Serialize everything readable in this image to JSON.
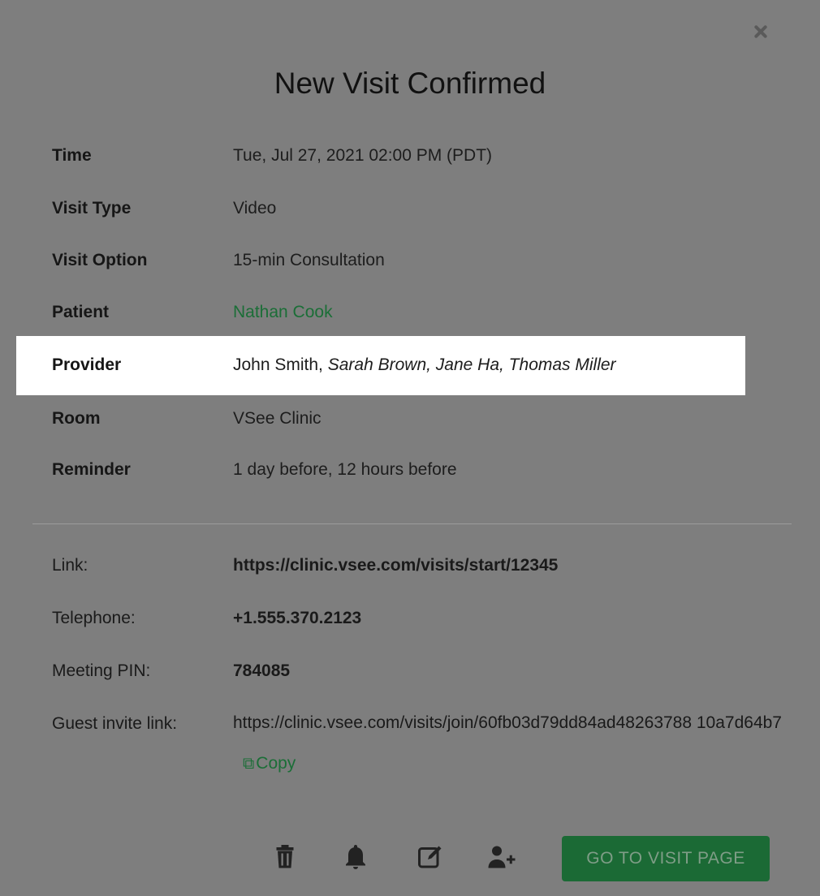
{
  "modal": {
    "title": "New Visit Confirmed"
  },
  "details": {
    "time_label": "Time",
    "time_value": "Tue, Jul 27, 2021 02:00 PM (PDT)",
    "visit_type_label": "Visit Type",
    "visit_type_value": "Video",
    "visit_option_label": "Visit Option",
    "visit_option_value": "15-min Consultation",
    "patient_label": "Patient",
    "patient_value": "Nathan Cook",
    "provider_label": "Provider",
    "provider_primary": "John Smith,",
    "provider_others": "Sarah Brown, Jane Ha, Thomas Miller",
    "room_label": "Room",
    "room_value": "VSee Clinic",
    "reminder_label": "Reminder",
    "reminder_value": "1 day before, 12 hours before"
  },
  "info": {
    "link_label": "Link:",
    "link_value": "https://clinic.vsee.com/visits/start/12345",
    "telephone_label": "Telephone:",
    "telephone_value": "+1.555.370.2123",
    "pin_label": "Meeting PIN:",
    "pin_value": "784085",
    "guest_label": "Guest invite link:",
    "guest_value": "https://clinic.vsee.com/visits/join/60fb03d79dd84ad48263788 10a7d64b7",
    "copy_label": "Copy"
  },
  "actions": {
    "goto_label": "GO TO VISIT PAGE",
    "icons": [
      "trash-icon",
      "bell-icon",
      "edit-icon",
      "add-user-icon"
    ]
  },
  "colors": {
    "overlay_bg": "#7e7e7e",
    "accent_green": "#1b6e37",
    "highlight_bg": "#ffffff"
  }
}
